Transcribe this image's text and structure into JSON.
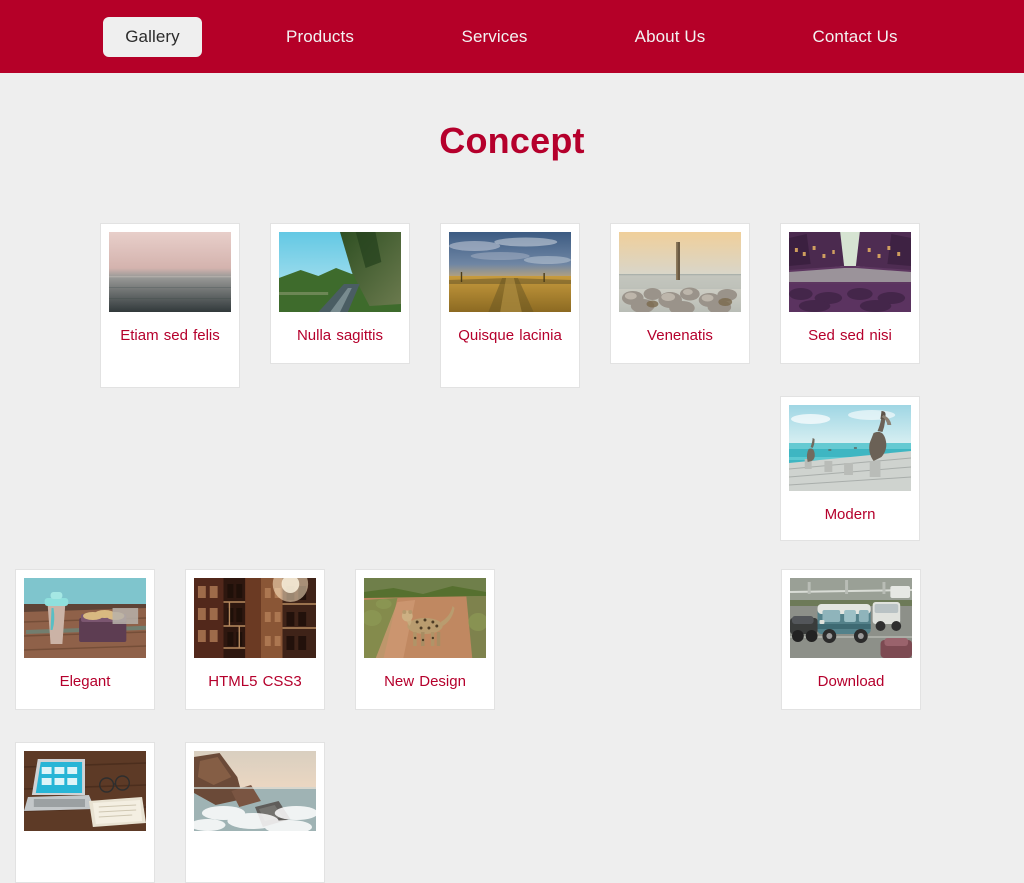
{
  "theme": {
    "navbar_bg": "#b50028",
    "accent": "#b5002c",
    "page_bg": "#eeeeee",
    "card_bg": "#ffffff",
    "card_border": "#e2e2e2",
    "nav_text": "#f2f2f2",
    "active_pill_bg": "#efefef",
    "active_pill_text": "#2b2b2b"
  },
  "nav": {
    "items": [
      {
        "label": "Gallery",
        "active": true
      },
      {
        "label": "Products",
        "active": false
      },
      {
        "label": "Services",
        "active": false
      },
      {
        "label": "About Us",
        "active": false
      },
      {
        "label": "Contact Us",
        "active": false
      }
    ]
  },
  "main": {
    "title": "Concept"
  },
  "gallery": {
    "items": [
      {
        "caption": "Etiam sed felis",
        "image": "calm-sea-horizon-photo"
      },
      {
        "caption": "Nulla sagittis",
        "image": "mountain-road-photo"
      },
      {
        "caption": "Quisque lacinia",
        "image": "wheat-field-clouds-photo"
      },
      {
        "caption": "Venenatis",
        "image": "rocks-pier-post-photo"
      },
      {
        "caption": "Sed sed nisi",
        "image": "canal-buildings-photo"
      },
      {
        "caption": "Modern",
        "image": "pelicans-on-pier-photo"
      },
      {
        "caption": "Elegant",
        "image": "coffee-cup-pastry-photo"
      },
      {
        "caption": "HTML5 CSS3",
        "image": "city-fire-escape-photo"
      },
      {
        "caption": "New Design",
        "image": "cheetah-dirt-road-photo"
      },
      {
        "caption": "Download",
        "image": "vintage-van-traffic-photo"
      },
      {
        "caption": "",
        "image": "laptop-desk-photo"
      },
      {
        "caption": "",
        "image": "rocky-coastline-photo"
      }
    ]
  }
}
